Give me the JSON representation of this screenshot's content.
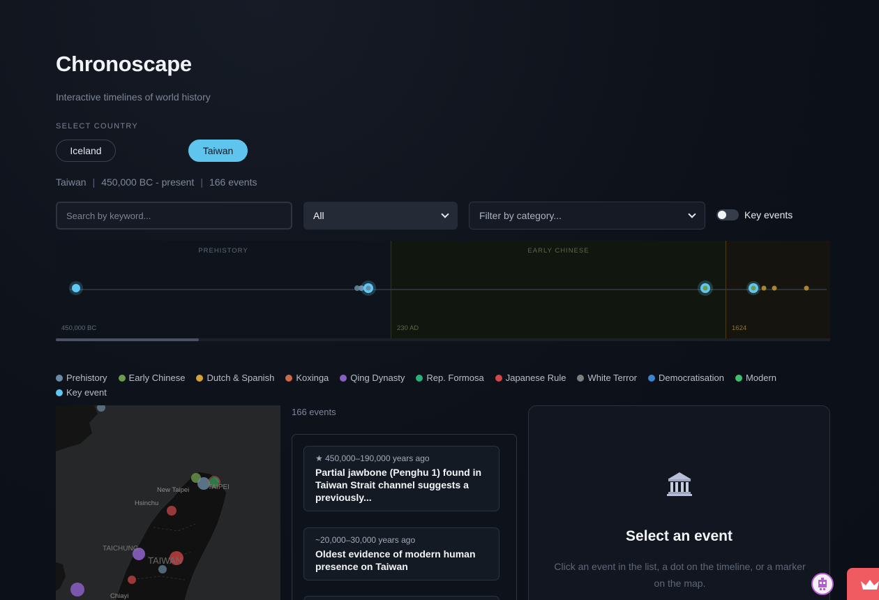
{
  "app": {
    "title": "Chronoscape",
    "subtitle": "Interactive timelines of world history"
  },
  "country_select": {
    "label": "SELECT COUNTRY",
    "options": [
      "Iceland",
      "Taiwan"
    ],
    "selected": "Taiwan"
  },
  "meta": {
    "country": "Taiwan",
    "range": "450,000 BC - present",
    "events": "166 events"
  },
  "filters": {
    "search_placeholder": "Search by keyword...",
    "period_value": "All",
    "category_placeholder": "Filter by category...",
    "key_events_label": "Key events",
    "key_events_on": false
  },
  "timeline": {
    "eras": [
      {
        "label": "PREHISTORY",
        "year": "450,000 BC",
        "color": "#6f8ea3"
      },
      {
        "label": "EARLY CHINESE",
        "year": "230 AD",
        "color": "#6f8a5a"
      },
      {
        "label": "",
        "year": "1624",
        "color": "#c9952f"
      }
    ]
  },
  "legend": [
    {
      "label": "Prehistory",
      "color": "#6b8ba4"
    },
    {
      "label": "Early Chinese",
      "color": "#6d9a4c"
    },
    {
      "label": "Dutch & Spanish",
      "color": "#d4a23a"
    },
    {
      "label": "Koxinga",
      "color": "#cc6a45"
    },
    {
      "label": "Qing Dynasty",
      "color": "#8a5fc4"
    },
    {
      "label": "Rep. Formosa",
      "color": "#27b07a"
    },
    {
      "label": "Japanese Rule",
      "color": "#d34848"
    },
    {
      "label": "White Terror",
      "color": "#7f7f7f"
    },
    {
      "label": "Democratisation",
      "color": "#3b84cf"
    },
    {
      "label": "Modern",
      "color": "#3fbf6d"
    },
    {
      "label": "Key event",
      "color": "#5ec8f2"
    }
  ],
  "map": {
    "labels": [
      "New Taipei",
      "TAIPEI",
      "Hsinchu",
      "TAICHUNG",
      "TAIWAN",
      "Chiayi"
    ]
  },
  "events_list": {
    "count": "166 events",
    "items": [
      {
        "date": "★ 450,000–190,000 years ago",
        "title": "Partial jawbone (Penghu 1) found in Taiwan Strait channel suggests a previously..."
      },
      {
        "date": "~20,000–30,000 years ago",
        "title": "Oldest evidence of modern human presence on Taiwan"
      }
    ]
  },
  "detail": {
    "icon": "museum-icon",
    "title": "Select an event",
    "text": "Click an event in the list, a dot on the timeline, or a marker on the map."
  }
}
